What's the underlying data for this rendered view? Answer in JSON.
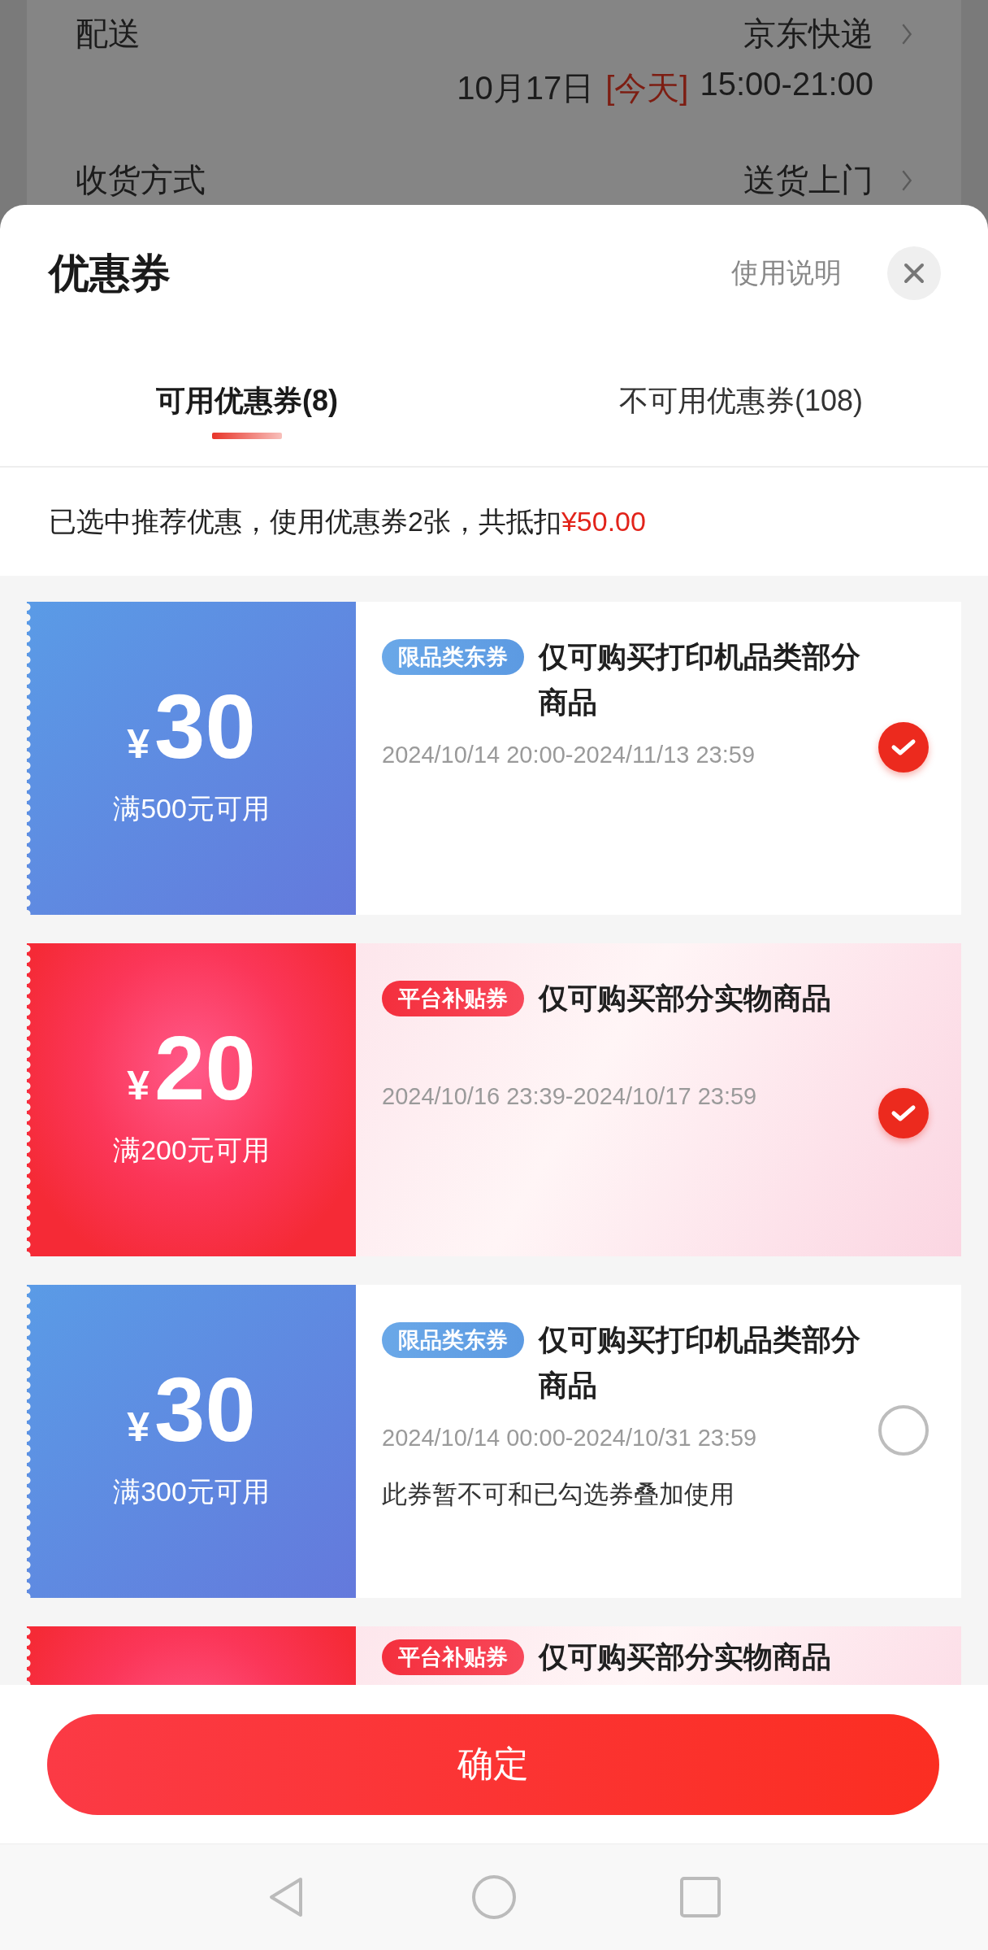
{
  "background": {
    "rows": [
      {
        "label": "配送",
        "value": "京东快递"
      },
      {
        "label": "收货方式",
        "value": "送货上门"
      }
    ],
    "delivery_time": {
      "date": "10月17日",
      "badge": "[今天]",
      "time": "15:00-21:00"
    }
  },
  "sheet": {
    "title": "优惠券",
    "help": "使用说明"
  },
  "tabs": [
    {
      "label": "可用优惠券(8)",
      "selected": true
    },
    {
      "label": "不可用优惠券(108)",
      "selected": false
    }
  ],
  "summary": {
    "text": "已选中推荐优惠，使用优惠券2张，共抵扣",
    "amount": "¥50.00"
  },
  "coupons": [
    {
      "kind": "category",
      "currency": "¥",
      "amount": "30",
      "condition": "满500元可用",
      "tag": "限品类东券",
      "title": "仅可购买打印机品类部分商品",
      "validity": "2024/10/14 20:00-2024/11/13 23:59",
      "selected": true
    },
    {
      "kind": "platform",
      "currency": "¥",
      "amount": "20",
      "condition": "满200元可用",
      "tag": "平台补贴券",
      "title": "仅可购买部分实物商品",
      "validity": "2024/10/16 23:39-2024/10/17 23:59",
      "selected": true
    },
    {
      "kind": "category",
      "currency": "¥",
      "amount": "30",
      "condition": "满300元可用",
      "tag": "限品类东券",
      "title": "仅可购买打印机品类部分商品",
      "validity": "2024/10/14 00:00-2024/10/31 23:59",
      "note": "此券暂不可和已勾选券叠加使用",
      "selected": false
    },
    {
      "kind": "platform",
      "tag": "平台补贴券",
      "title": "仅可购买部分实物商品"
    }
  ],
  "confirm_button": "确定"
}
